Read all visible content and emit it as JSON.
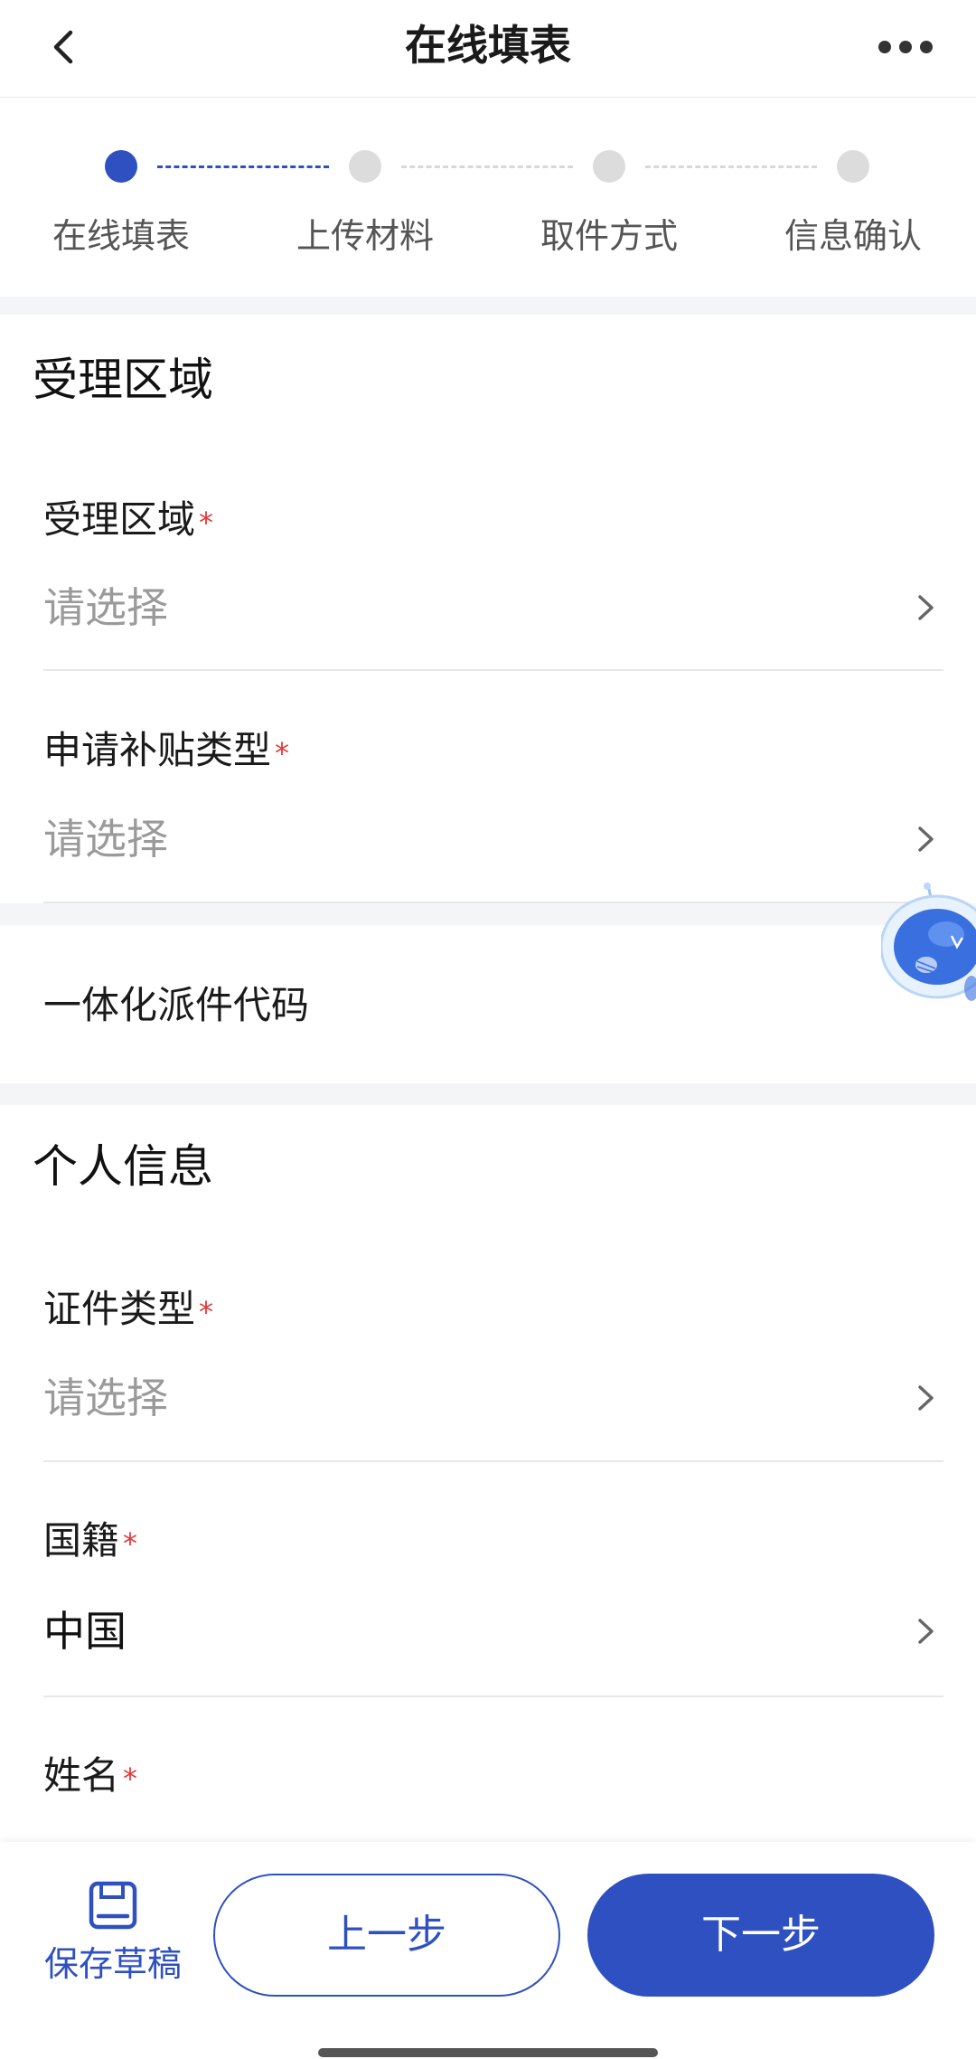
{
  "nav": {
    "title": "在线填表",
    "back_icon": "chevron-left-icon",
    "more_icon": "more-dots-icon"
  },
  "steps": [
    {
      "label": "在线填表",
      "active": true
    },
    {
      "label": "上传材料",
      "active": false
    },
    {
      "label": "取件方式",
      "active": false
    },
    {
      "label": "信息确认",
      "active": false
    }
  ],
  "section_area": {
    "title": "受理区域",
    "fields": [
      {
        "label": "受理区域",
        "required": "*",
        "value": "请选择"
      },
      {
        "label": "申请补贴类型",
        "required": "*",
        "value": "请选择"
      }
    ]
  },
  "dispatch_code": {
    "label": "一体化派件代码"
  },
  "section_personal": {
    "title": "个人信息",
    "fields": [
      {
        "label": "证件类型",
        "required": "*",
        "value": "请选择"
      },
      {
        "label": "国籍",
        "required": "*",
        "value": "中国"
      },
      {
        "label": "姓名",
        "required": "*"
      }
    ]
  },
  "bottom": {
    "save_draft": "保存草稿",
    "prev": "上一步",
    "next": "下一步"
  },
  "colors": {
    "primary": "#2f50c0",
    "required": "#e03a3a",
    "placeholder": "#9a9a9a"
  }
}
